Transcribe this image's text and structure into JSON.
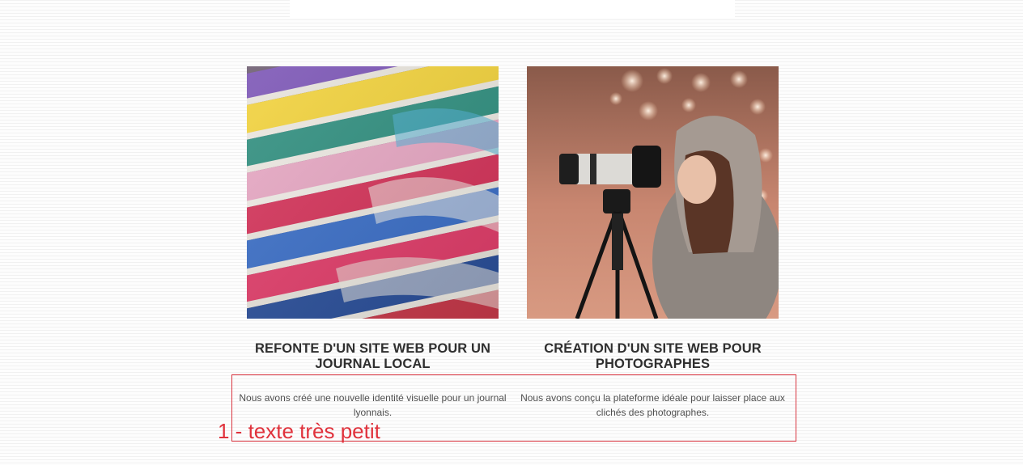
{
  "projects": [
    {
      "image": "magazine-stack-photo",
      "title": "Refonte d'un site web pour un journal local",
      "description": "Nous avons créé une nouvelle identité visuelle pour un journal lyonnais."
    },
    {
      "image": "photographer-tripod-photo",
      "title": "Création d'un site web pour photographes",
      "description": "Nous avons conçu la plateforme idéale pour laisser place aux clichés des photographes."
    }
  ],
  "annotation": {
    "label": "1 - texte très petit",
    "color": "#e0323c"
  }
}
